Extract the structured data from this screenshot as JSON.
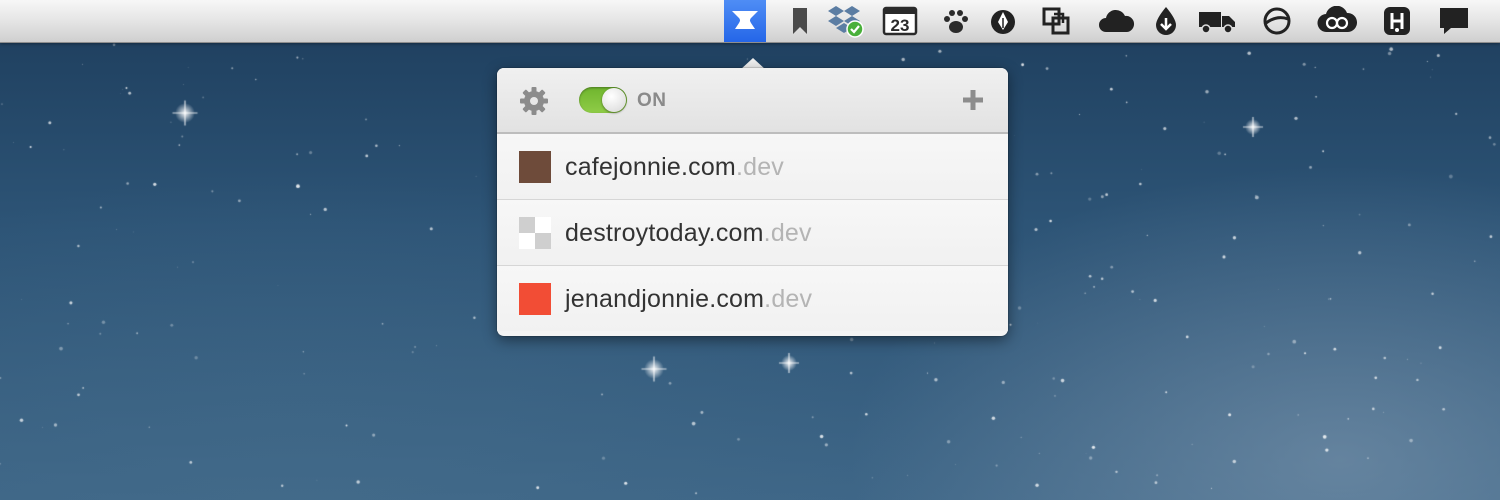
{
  "menubar": {
    "items": [
      {
        "name": "pow-anvil-icon",
        "active": true
      },
      {
        "name": "bookmark-icon"
      },
      {
        "name": "dropbox-icon"
      },
      {
        "name": "calendar-icon",
        "text": "23"
      },
      {
        "name": "paw-icon"
      },
      {
        "name": "pen-nib-icon"
      },
      {
        "name": "window-resize-icon"
      },
      {
        "name": "cloud-icon"
      },
      {
        "name": "drop-download-icon"
      },
      {
        "name": "truck-icon"
      },
      {
        "name": "circle-arc-icon"
      },
      {
        "name": "creative-cloud-icon"
      },
      {
        "name": "app-h-icon"
      },
      {
        "name": "speech-bubble-icon"
      }
    ]
  },
  "popover": {
    "toggle": {
      "state": "ON",
      "on": true
    },
    "sites": [
      {
        "name": "cafejonnie.com",
        "tld": ".dev",
        "color": "#6e4b3a",
        "swatch": "solid"
      },
      {
        "name": "destroytoday.com",
        "tld": ".dev",
        "color": "#cfcfcf",
        "swatch": "checker"
      },
      {
        "name": "jenandjonnie.com",
        "tld": ".dev",
        "color": "#f24d35",
        "swatch": "solid"
      }
    ]
  }
}
